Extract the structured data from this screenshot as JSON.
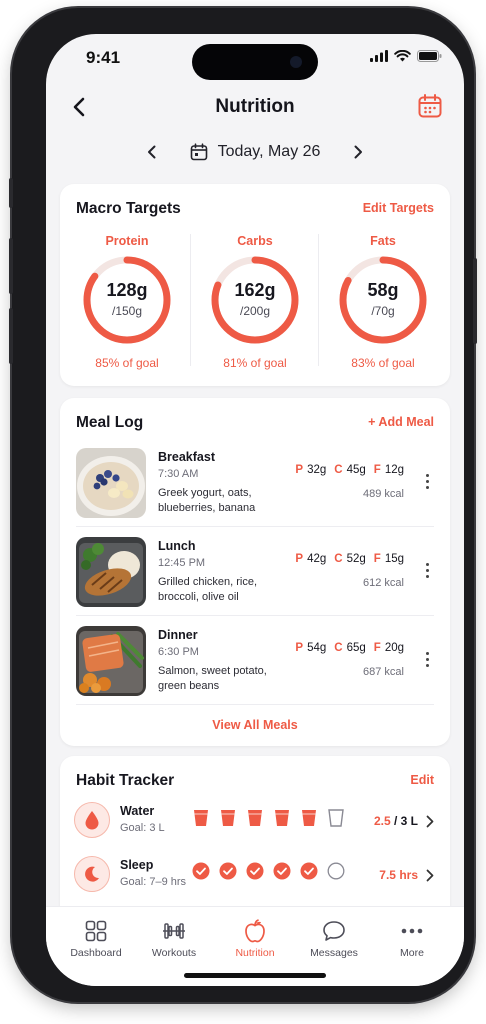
{
  "status_bar": {
    "time": "9:41"
  },
  "header": {
    "title": "Nutrition",
    "back_icon": "chevron-left-icon",
    "calendar_icon": "calendar-icon"
  },
  "date_nav": {
    "label": "Today, May 26"
  },
  "macro_targets": {
    "title": "Macro Targets",
    "action": "Edit Targets",
    "items": [
      {
        "name": "Protein",
        "value": "128g",
        "goal": "/150g",
        "percent_label": "85% of goal",
        "progress": 0.85
      },
      {
        "name": "Carbs",
        "value": "162g",
        "goal": "/200g",
        "percent_label": "81% of goal",
        "progress": 0.81
      },
      {
        "name": "Fats",
        "value": "58g",
        "goal": "/70g",
        "percent_label": "83% of goal",
        "progress": 0.83
      }
    ]
  },
  "meal_log": {
    "title": "Meal Log",
    "action": "+ Add Meal",
    "meals": [
      {
        "name": "Breakfast",
        "time": "7:30 AM",
        "desc": "Greek yogurt, oats, blueberries, banana",
        "p_key": "P",
        "p": "32g",
        "c_key": "C",
        "c": "45g",
        "f_key": "F",
        "f": "12g",
        "kcal": "489 kcal"
      },
      {
        "name": "Lunch",
        "time": "12:45 PM",
        "desc": "Grilled chicken, rice, broccoli, olive oil",
        "p_key": "P",
        "p": "42g",
        "c_key": "C",
        "c": "52g",
        "f_key": "F",
        "f": "15g",
        "kcal": "612 kcal"
      },
      {
        "name": "Dinner",
        "time": "6:30 PM",
        "desc": "Salmon, sweet potato, green beans",
        "p_key": "P",
        "p": "54g",
        "c_key": "C",
        "c": "65g",
        "f_key": "F",
        "f": "20g",
        "kcal": "687 kcal"
      }
    ],
    "view_all": "View All Meals"
  },
  "habit_tracker": {
    "title": "Habit Tracker",
    "action": "Edit",
    "habits": [
      {
        "name": "Water",
        "goal": "Goal: 3 L",
        "value": "2.5",
        "sep": " / ",
        "target": "3 L",
        "filled": 5,
        "total": 6,
        "icon": "water-drop-icon"
      },
      {
        "name": "Sleep",
        "goal": "Goal: 7–9 hrs",
        "value": "7.5 hrs",
        "filled": 5,
        "total": 6,
        "icon": "moon-icon"
      }
    ]
  },
  "tabbar": {
    "tabs": [
      {
        "label": "Dashboard",
        "icon": "grid-icon"
      },
      {
        "label": "Workouts",
        "icon": "dumbbell-icon"
      },
      {
        "label": "Nutrition",
        "icon": "apple-icon",
        "active": true
      },
      {
        "label": "Messages",
        "icon": "chat-bubble-icon"
      },
      {
        "label": "More",
        "icon": "more-dots-icon"
      }
    ]
  },
  "colors": {
    "accent": "#ee5a45",
    "ring_track": "#f3e5e2",
    "background": "#f4f4f6"
  }
}
